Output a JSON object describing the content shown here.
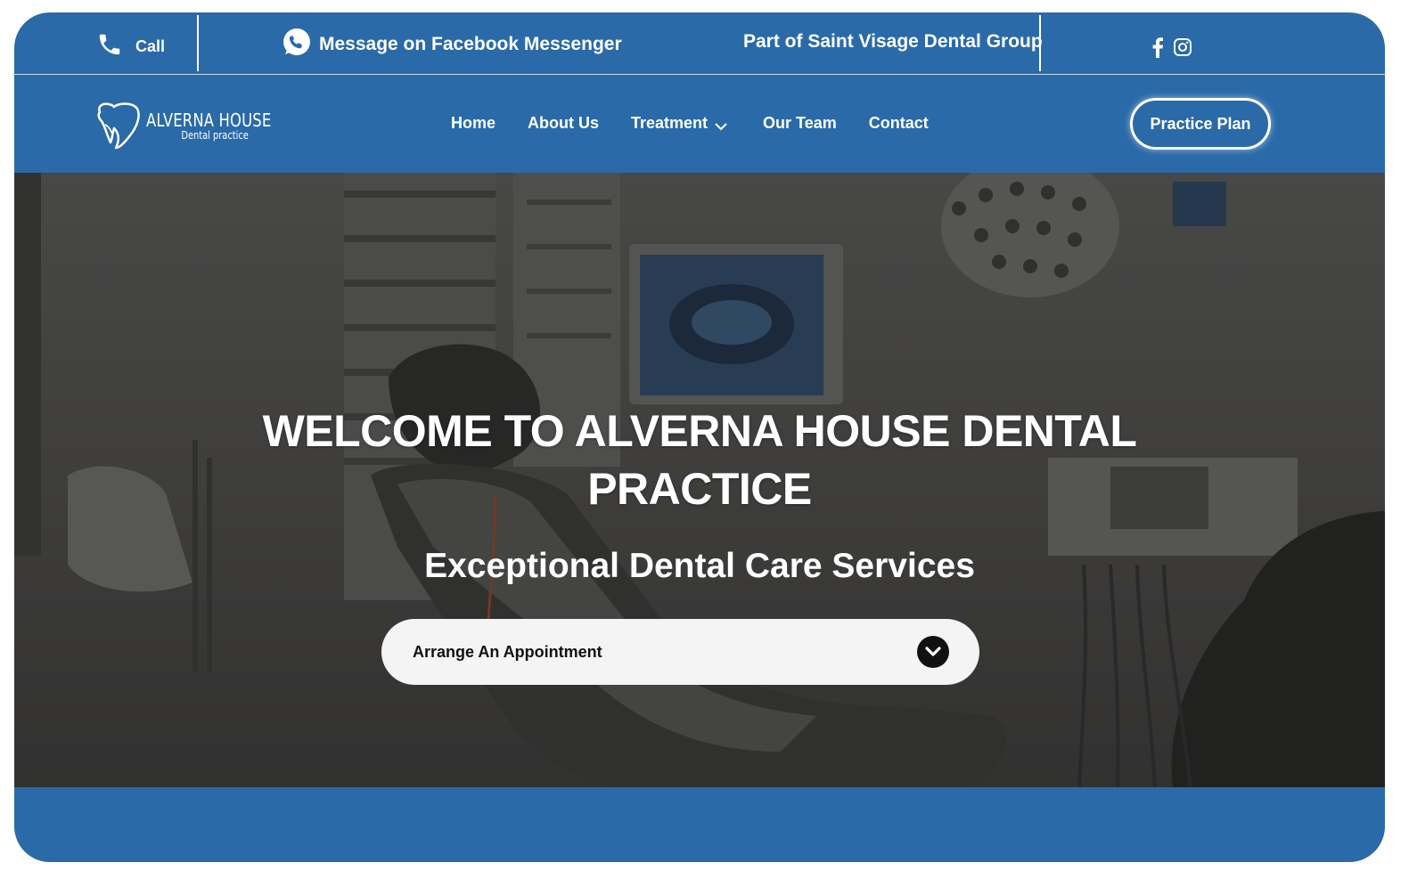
{
  "topbar": {
    "call_label": "Call",
    "messenger_label": "Message on Facebook Messenger",
    "group_label": "Part of Saint Visage Dental Group",
    "social_icons": [
      "facebook-icon",
      "instagram-icon"
    ]
  },
  "logo": {
    "title": "ALVERNA HOUSE",
    "subtitle": "Dental practice"
  },
  "nav": {
    "items": [
      {
        "label": "Home"
      },
      {
        "label": "About Us"
      },
      {
        "label": "Treatment",
        "dropdown": true
      },
      {
        "label": "Our Team"
      },
      {
        "label": "Contact"
      }
    ],
    "cta_label": "Practice Plan"
  },
  "hero": {
    "title_line1": "WELCOME TO ALVERNA HOUSE DENTAL",
    "title_line2": "PRACTICE",
    "subtitle": "Exceptional Dental Care Services",
    "appointment_label": "Arrange An Appointment"
  },
  "colors": {
    "brand_blue": "#2a6aa8",
    "white": "#ffffff",
    "dark": "#111111"
  }
}
